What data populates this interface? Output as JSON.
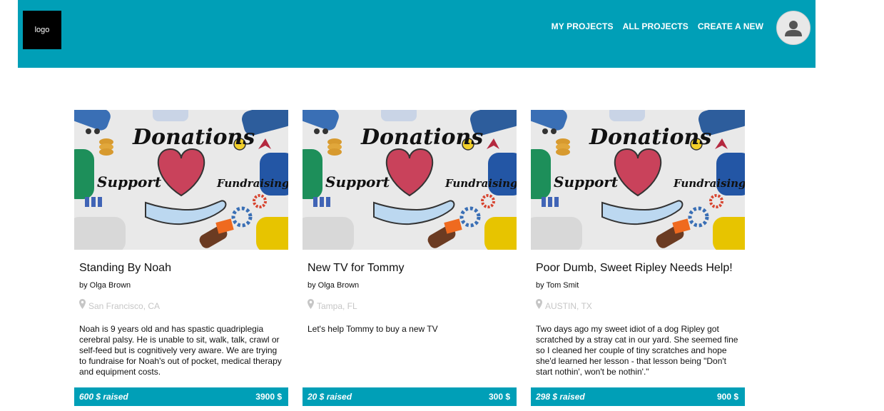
{
  "header": {
    "logo_text": "logo",
    "nav": [
      {
        "label": "MY PROJECTS"
      },
      {
        "label": "ALL PROJECTS"
      },
      {
        "label": "CREATE A NEW"
      }
    ],
    "avatar_icon": "user-avatar-icon"
  },
  "colors": {
    "brand": "#009fb7",
    "location_text": "#c6c6c6"
  },
  "image_text": {
    "donations": "Donations",
    "support": "Support",
    "fundraising": "Fundraising"
  },
  "cards": [
    {
      "title": "Standing By Noah",
      "author": "by Olga Brown",
      "location": "San Francisco, CA",
      "description": "Noah is 9 years old and has spastic quadriplegia cerebral palsy. He is unable to sit, walk, talk, crawl or self-feed but is cognitively very aware. We are trying to fundraise for Noah's out of pocket, medical therapy and equipment costs.",
      "raised": "600 $ raised",
      "goal": "3900 $"
    },
    {
      "title": "New TV for Tommy",
      "author": "by Olga Brown",
      "location": "Tampa, FL",
      "description": "Let's help Tommy to buy a new TV",
      "raised": "20 $ raised",
      "goal": "300 $"
    },
    {
      "title": "Poor Dumb, Sweet Ripley Needs Help!",
      "author": "by Tom Smit",
      "location": "AUSTIN, TX",
      "description": "Two days ago my sweet idiot of a dog Ripley got scratched by a stray cat in our yard. She seemed fine so I cleaned her couple of tiny scratches and hope she'd learned her lesson - that lesson being \"Don't start nothin', won't be nothin'.\"",
      "raised": "298 $ raised",
      "goal": "900 $"
    }
  ]
}
